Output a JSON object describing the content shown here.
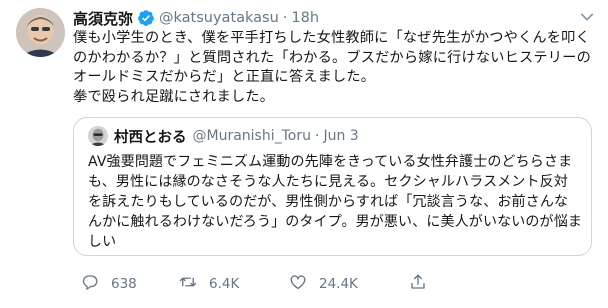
{
  "tweet": {
    "author_name": "高須克弥",
    "handle": "@katsuyatakasu",
    "separator": "·",
    "time": "18h",
    "text": "僕も小学生のとき、僕を平手打ちした女性教師に「なぜ先生がかつやくんを叩くのかわかるか？」と質問された「わかる。ブスだから嫁に行けないヒステリーのオールドミスだからだ」と正直に答えました。\n拳で殴られ足蹴にされました。",
    "icons": {
      "avatar": "profile-photo",
      "verified": "verified-badge-icon",
      "more": "chevron-down-icon"
    }
  },
  "quoted_tweet": {
    "author_name": "村西とおる",
    "handle": "@Muranishi_Toru",
    "separator": "·",
    "time": "Jun 3",
    "text": "AV強要問題でフェミニズム運動の先陣をきっている女性弁護士のどちらさまも、男性には縁のなさそうな人たちに見える。セクシャルハラスメント反対を訴えたりもしているのだが、男性側からすれば「冗談言うな、お前さんなんかに触れるわけないだろう」のタイプ。男が悪い、に美人がいないのが悩ましい"
  },
  "actions": {
    "reply_count": "638",
    "retweet_count": "6.4K",
    "like_count": "24.4K",
    "icons": [
      "reply-icon",
      "retweet-icon",
      "like-icon",
      "share-icon"
    ]
  },
  "colors": {
    "text": "#14171a",
    "secondary": "#657786",
    "verified": "#1da1f2",
    "border": "#ccd6dd"
  }
}
